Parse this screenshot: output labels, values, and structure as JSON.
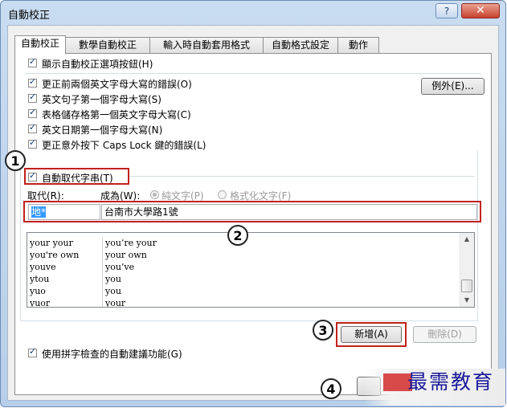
{
  "window": {
    "title": "自動校正",
    "help": "?",
    "close": "✕"
  },
  "tabs": [
    "自動校正",
    "數學自動校正",
    "輸入時自動套用格式",
    "自動格式設定",
    "動作"
  ],
  "options": {
    "show_button": "顯示自動校正選項按鈕(H)",
    "two_caps": "更正前兩個英文字母大寫的錯誤(O)",
    "sentence": "英文句子第一個字母大寫(S)",
    "table_cell": "表格儲存格第一個英文字母大寫(C)",
    "days": "英文日期第一個字母大寫(N)",
    "caps_lock": "更正意外按下 Caps Lock 鍵的錯誤(L)",
    "exceptions_button": "例外(E)..."
  },
  "replace": {
    "checkbox_label": "自動取代字串(T)",
    "replace_label": "取代(R):",
    "with_label": "成為(W):",
    "plain_text": "純文字(P)",
    "formatted_text": "格式化文字(F)",
    "replace_value": "地*",
    "with_value": "台南市大學路1號"
  },
  "entries": [
    {
      "from": "your your",
      "to": "you’re your"
    },
    {
      "from": "you're own",
      "to": "your own"
    },
    {
      "from": "youve",
      "to": "you’ve"
    },
    {
      "from": "ytou",
      "to": "you"
    },
    {
      "from": "yuo",
      "to": "you"
    },
    {
      "from": "yuor",
      "to": "your"
    }
  ],
  "buttons": {
    "add": "新增(A)",
    "delete": "刪除(D)"
  },
  "spell_suggest": "使用拼字檢查的自動建議功能(G)",
  "markers": [
    "1",
    "2",
    "3",
    "4"
  ],
  "watermark": "最需教育"
}
